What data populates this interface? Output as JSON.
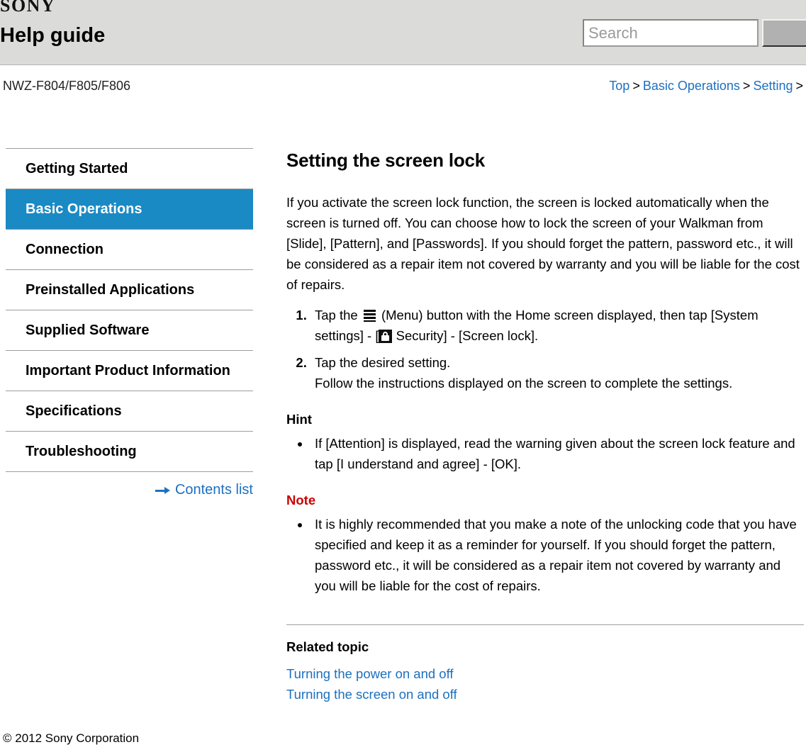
{
  "header": {
    "logo_text": "SONY",
    "title": "Help guide",
    "search_placeholder": "Search",
    "search_value": "",
    "search_button_label": ""
  },
  "crumbbar": {
    "model": "NWZ-F804/F805/F806",
    "breadcrumb": [
      {
        "label": "Top",
        "link": true
      },
      {
        "label": ">",
        "link": false
      },
      {
        "label": "Basic Operations",
        "link": true
      },
      {
        "label": ">",
        "link": false
      },
      {
        "label": "Setting",
        "link": true
      },
      {
        "label": ">",
        "link": false
      }
    ]
  },
  "sidebar": {
    "items": [
      {
        "label": "Getting Started",
        "active": false
      },
      {
        "label": "Basic Operations",
        "active": true
      },
      {
        "label": "Connection",
        "active": false
      },
      {
        "label": "Preinstalled Applications",
        "active": false
      },
      {
        "label": "Supplied Software",
        "active": false
      },
      {
        "label": "Important Product Information",
        "active": false
      },
      {
        "label": "Specifications",
        "active": false
      },
      {
        "label": "Troubleshooting",
        "active": false
      }
    ],
    "contents_list_label": "Contents list",
    "active_color": "#1a8ac4"
  },
  "article": {
    "title": "Setting the screen lock",
    "intro": "If you activate the screen lock function, the screen is locked automatically when the screen is turned off. You can choose how to lock the screen of your Walkman from [Slide], [Pattern], and [Passwords]. If you should forget the pattern, password etc., it will be considered as a repair item not covered by warranty and you will be liable for the cost of repairs.",
    "steps": [
      {
        "text_before_menu_icon": "Tap the ",
        "text_after_menu_icon": " (Menu) button with the Home screen displayed, then tap [System settings] - [",
        "text_after_lock_icon": " Security] - [Screen lock]."
      },
      {
        "line1": "Tap the desired setting.",
        "line2": "Follow the instructions displayed on the screen to complete the settings."
      }
    ],
    "hint": {
      "heading": "Hint",
      "bullets": [
        "If [Attention] is displayed, read the warning given about the screen lock feature and tap [I understand and agree] - [OK]."
      ]
    },
    "note": {
      "heading": "Note",
      "heading_color": "#cc0000",
      "bullets": [
        "It is highly recommended that you make a note of the unlocking code that you have specified and keep it as a reminder for yourself. If you should forget the pattern, password etc., it will be considered as a repair item not covered by warranty and you will be liable for the cost of repairs."
      ]
    },
    "related": {
      "heading": "Related topic",
      "links": [
        "Turning the power on and off",
        "Turning the screen on and off"
      ]
    }
  },
  "footer": {
    "copyright": "© 2012 Sony Corporation"
  }
}
